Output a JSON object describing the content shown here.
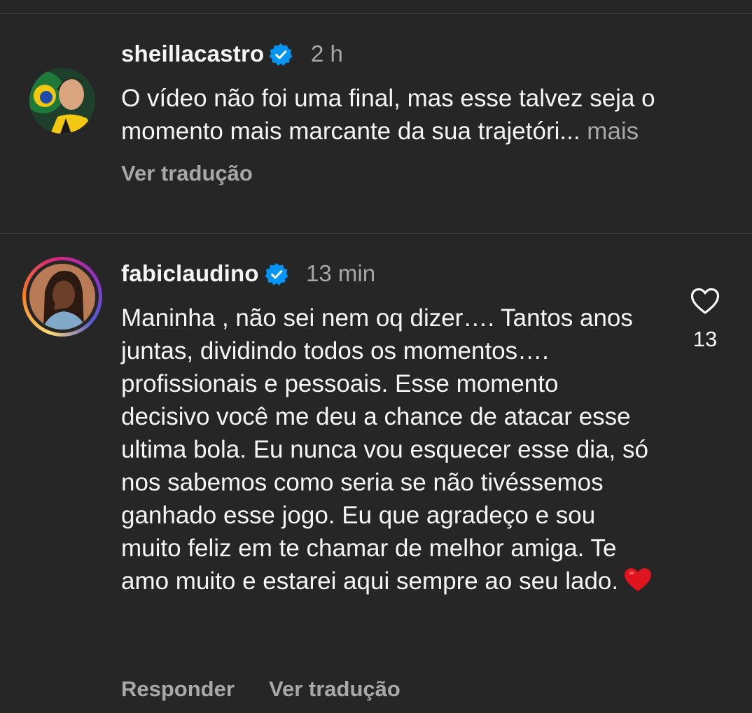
{
  "comments": [
    {
      "username": "sheillacastro",
      "verified": true,
      "time": "2 h",
      "text": "O vídeo não foi uma final, mas esse talvez seja o momento mais marcante da sua trajetóri...",
      "more_label": " mais",
      "actions": [
        "Ver tradução"
      ],
      "avatar_icon": "profile-photo"
    },
    {
      "username": "fabiclaudino",
      "verified": true,
      "has_story_ring": true,
      "time": "13 min",
      "text": "Maninha , não sei nem oq dizer…. Tantos anos juntas, dividindo todos os momentos…. profissionais e pessoais. Esse momento decisivo você me deu a chance de atacar esse ultima bola. Eu nunca vou esquecer esse dia, só nos sabemos como seria se não tivéssemos ganhado esse jogo. Eu que agradeço e sou muito feliz em te chamar de melhor amiga. Te amo muito e estarei aqui sempre ao seu lado.",
      "emoji": "❤️",
      "actions": [
        "Responder",
        "Ver tradução"
      ],
      "like_count": "13",
      "avatar_icon": "profile-photo"
    }
  ],
  "colors": {
    "background": "#262626",
    "primary_text": "#f5f5f5",
    "secondary_text": "#a8a8a8",
    "verified_badge": "#0095f6"
  }
}
